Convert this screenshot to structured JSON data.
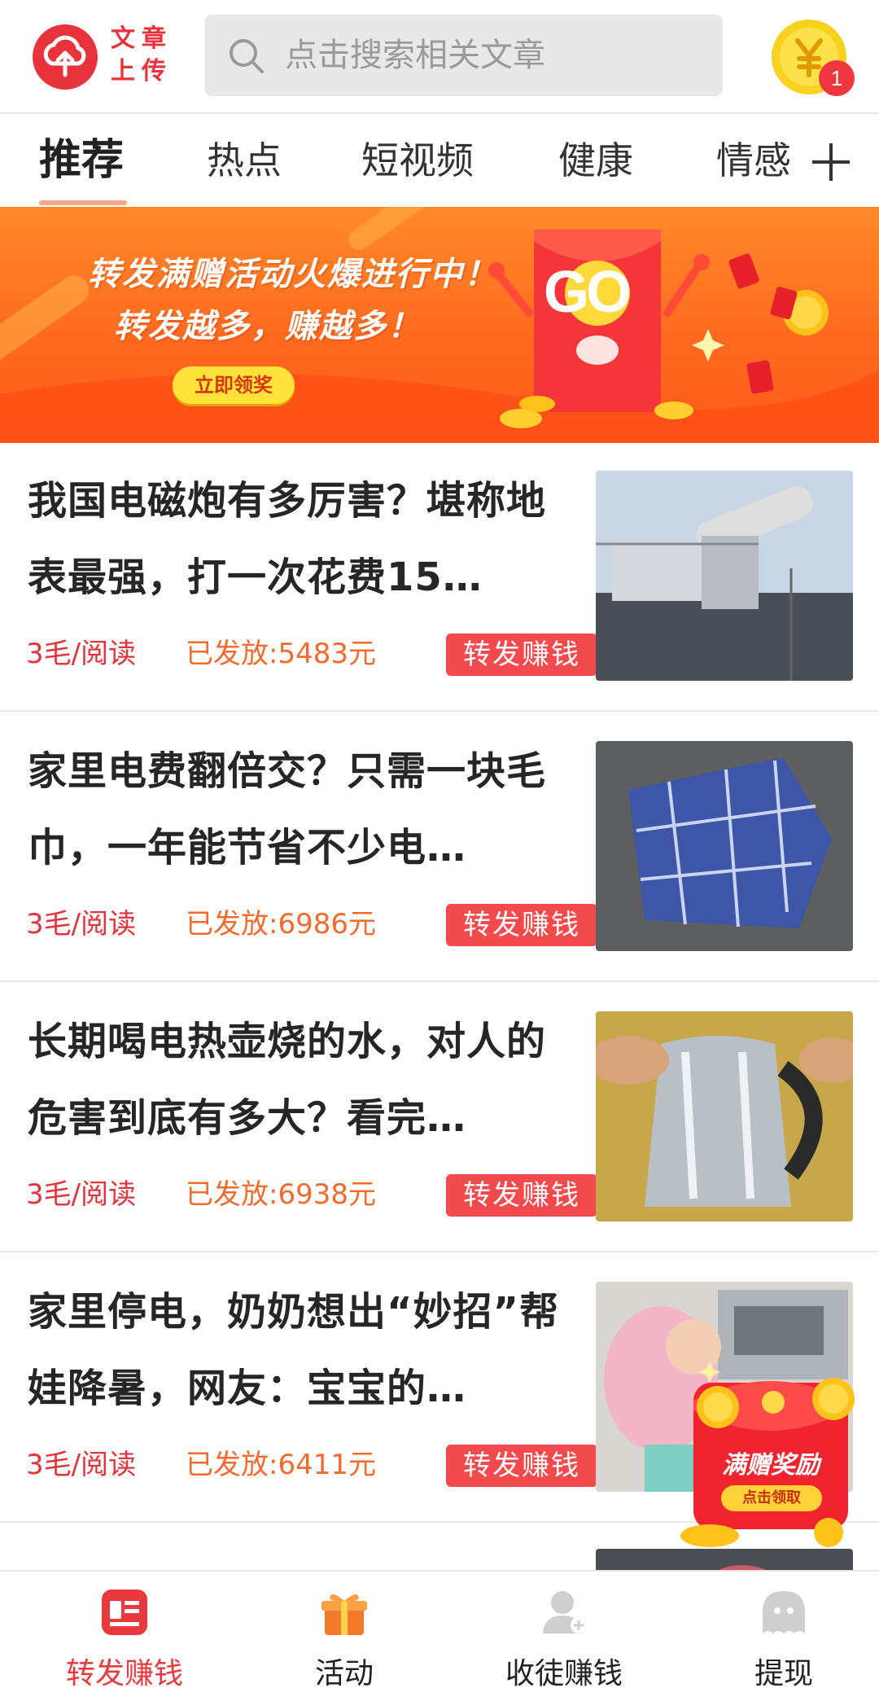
{
  "header": {
    "logo_text": "文章上传",
    "search_placeholder": "点击搜索相关文章",
    "coin_icon": "yuan-coin-icon",
    "coin_badge": "1"
  },
  "tabs": [
    {
      "label": "推荐",
      "active": true
    },
    {
      "label": "热点",
      "active": false
    },
    {
      "label": "短视频",
      "active": false
    },
    {
      "label": "健康",
      "active": false
    },
    {
      "label": "情感",
      "active": false
    }
  ],
  "banner": {
    "line1": "转发满赠活动火爆进行中！",
    "line2": "转发越多，赚越多！",
    "button": "立即领奖",
    "packet_text": "GO"
  },
  "articles": [
    {
      "title": "我国电磁炮有多厉害？堪称地表最强，打一次花费15…",
      "price": "3毛/阅读",
      "paid": "已发放:5483元",
      "share": "转发赚钱"
    },
    {
      "title": "家里电费翻倍交？只需一块毛巾，一年能节省不少电…",
      "price": "3毛/阅读",
      "paid": "已发放:6986元",
      "share": "转发赚钱"
    },
    {
      "title": "长期喝电热壶烧的水，对人的危害到底有多大？看完…",
      "price": "3毛/阅读",
      "paid": "已发放:6938元",
      "share": "转发赚钱"
    },
    {
      "title": "家里停电，奶奶想出“妙招”帮娃降暑，网友：宝宝的…",
      "price": "3毛/阅读",
      "paid": "已发放:6411元",
      "share": "转发赚钱"
    }
  ],
  "float_packet": {
    "label": "满赠奖励",
    "button": "点击领取"
  },
  "bottom_nav": [
    {
      "label": "转发赚钱",
      "icon": "article-card-icon",
      "active": true
    },
    {
      "label": "活动",
      "icon": "gift-icon",
      "active": false
    },
    {
      "label": "收徒赚钱",
      "icon": "add-user-icon",
      "active": false
    },
    {
      "label": "提现",
      "icon": "ghost-wallet-icon",
      "active": false
    }
  ],
  "colors": {
    "brand_red": "#e8323c",
    "accent_orange": "#f26b2d",
    "share_button": "#f24a4d"
  }
}
